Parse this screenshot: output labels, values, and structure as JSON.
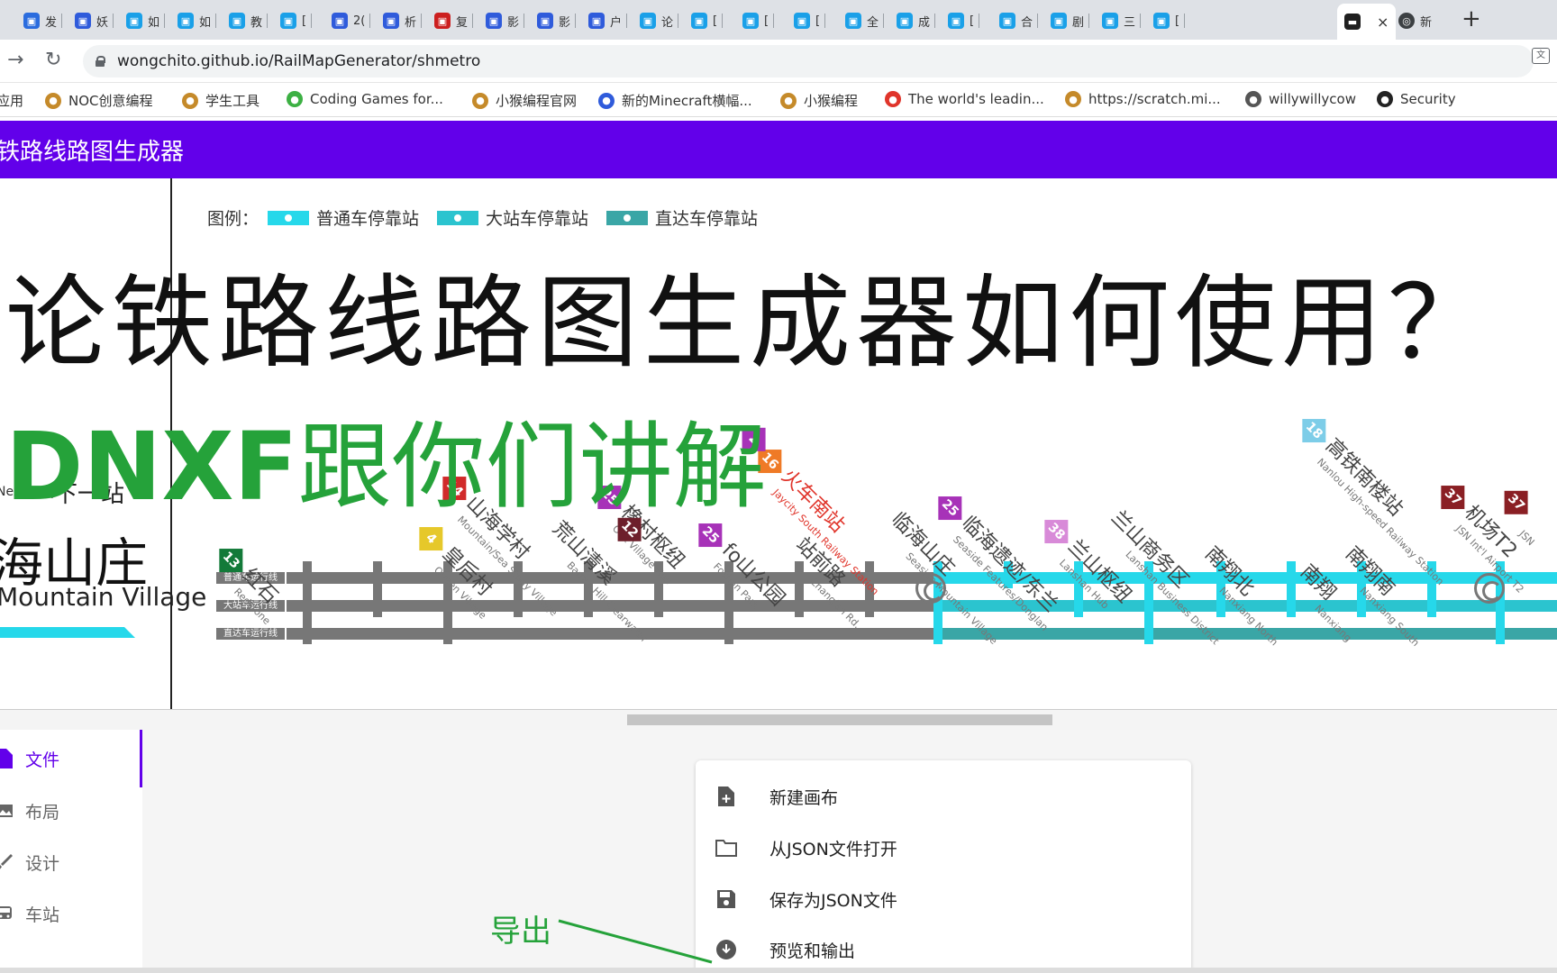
{
  "browser": {
    "tabs": [
      {
        "label": "发",
        "color": "#2b6cde"
      },
      {
        "label": "妖",
        "color": "#2f5bdb"
      },
      {
        "label": "如",
        "color": "#1aa0e8"
      },
      {
        "label": "如",
        "color": "#1aa0e8"
      },
      {
        "label": "教",
        "color": "#1aa0e8"
      },
      {
        "label": "[",
        "color": "#1aa0e8"
      },
      {
        "label": "2(",
        "color": "#2f5bdb"
      },
      {
        "label": "析",
        "color": "#2f5bdb"
      },
      {
        "label": "复",
        "color": "#cc1f1f"
      },
      {
        "label": "影",
        "color": "#2f5bdb"
      },
      {
        "label": "影",
        "color": "#2f5bdb"
      },
      {
        "label": "户",
        "color": "#2f5bdb"
      },
      {
        "label": "论",
        "color": "#1aa0e8"
      },
      {
        "label": "[",
        "color": "#1aa0e8"
      },
      {
        "label": "[",
        "color": "#1aa0e8"
      },
      {
        "label": "[",
        "color": "#1aa0e8"
      },
      {
        "label": "全",
        "color": "#1aa0e8"
      },
      {
        "label": "成",
        "color": "#1aa0e8"
      },
      {
        "label": "[",
        "color": "#1aa0e8"
      },
      {
        "label": "合",
        "color": "#1aa0e8"
      },
      {
        "label": "剧",
        "color": "#1aa0e8"
      },
      {
        "label": "三",
        "color": "#1aa0e8"
      },
      {
        "label": "[",
        "color": "#1aa0e8"
      }
    ],
    "active_tab": {
      "label": "",
      "close": "×"
    },
    "last_tab": {
      "label": "新"
    },
    "new_tab": "+",
    "url": "wongchito.github.io/RailMapGenerator/shmetro",
    "bookmarks": [
      {
        "label": "应用",
        "color": "#4285f4"
      },
      {
        "label": "NOC创意编程",
        "color": "#c58a2a"
      },
      {
        "label": "学生工具",
        "color": "#c58a2a"
      },
      {
        "label": "Coding Games for...",
        "color": "#3cb043"
      },
      {
        "label": "小猴编程官网",
        "color": "#c58a2a"
      },
      {
        "label": "新的Minecraft横幅...",
        "color": "#2f5bdb"
      },
      {
        "label": "小猴编程",
        "color": "#c58a2a"
      },
      {
        "label": "The world's leadin...",
        "color": "#e0342a"
      },
      {
        "label": "https://scratch.mi...",
        "color": "#c58a2a"
      },
      {
        "label": "willywillycow",
        "color": "#555555"
      },
      {
        "label": "Security",
        "color": "#222222"
      }
    ]
  },
  "app": {
    "title": "铁路线路图生成器",
    "accent": "#6200ea"
  },
  "preview": {
    "legend_label": "图例：",
    "legend": [
      {
        "label": "普通车停靠站",
        "color": "#26d8ea"
      },
      {
        "label": "大站车停靠站",
        "color": "#2bc4cf"
      },
      {
        "label": "直达车停靠站",
        "color": "#3aa6a6"
      }
    ],
    "headline": "论铁路线路图生成器如何使用？",
    "subline_latin": "DNXF",
    "subline_cn": "跟你们讲解",
    "next_stop_en": "Next Stop",
    "next_stop_cn": "下一站",
    "current_cn": "海山庄",
    "current_en": "Mountain Village",
    "track_labels": [
      "普通车运行线",
      "大站车运行线",
      "直达车运行线"
    ],
    "stations": [
      {
        "line": "13",
        "color": "#137a39",
        "cn": "红石",
        "en": "Redstone"
      },
      {
        "line": "4",
        "color": "#e6c82a",
        "cn": "皇后村",
        "en": "Queen Village"
      },
      {
        "line": "14",
        "color": "#d12a2a",
        "cn": "山海学村",
        "en": "Mountain/Sea Study Village"
      },
      {
        "line": "",
        "color": "",
        "cn": "荒山清溪",
        "en": "Barren Hill Clearwater"
      },
      {
        "line": "25",
        "color": "#a732b8",
        "cn": "橡村枢纽",
        "en": "Oak Village Hub"
      },
      {
        "line": "12",
        "color": "#6d1f2b",
        "cn": "",
        "en": ""
      },
      {
        "line": "25",
        "color": "#a732b8",
        "cn": "fo山公园",
        "en": "Foshan Park"
      },
      {
        "line": "",
        "color": "",
        "cn": "站前路",
        "en": "Zhanqian Rd."
      },
      {
        "line": "16",
        "color": "#ef7a26",
        "cn": "火车南站",
        "en": "Jaycity South Railway Station"
      },
      {
        "line": "2",
        "color": "#a732b8",
        "cn": "",
        "en": ""
      },
      {
        "line": "",
        "color": "",
        "cn": "临海山庄",
        "en": "Seaside Mountain Village"
      },
      {
        "line": "25",
        "color": "#a732b8",
        "cn": "临海遗迹/东兰",
        "en": "Seaside Features/Donglan"
      },
      {
        "line": "38",
        "color": "#d88ad8",
        "cn": "兰山枢纽",
        "en": "Lanshan Hub"
      },
      {
        "line": "",
        "color": "",
        "cn": "兰山商务区",
        "en": "Lanshan Business District"
      },
      {
        "line": "",
        "color": "",
        "cn": "南翔北",
        "en": "Nanxiang North"
      },
      {
        "line": "",
        "color": "",
        "cn": "南翔",
        "en": "Nanxiang"
      },
      {
        "line": "",
        "color": "",
        "cn": "南翔南",
        "en": "Nanxiang South"
      },
      {
        "line": "18",
        "color": "#7dcde8",
        "cn": "高铁南楼站",
        "en": "Nanlou High-speed Railway Station"
      },
      {
        "line": "37",
        "color": "#8a1f24",
        "cn": "机场T2",
        "en": "JSN Int'l Airport T2"
      },
      {
        "line": "37",
        "color": "#8a1f24",
        "cn": "",
        "en": "JSN"
      }
    ],
    "annotation": "导出",
    "track_colors": {
      "gray": "#777777",
      "cyan": "#26d8ea",
      "teal": "#3aa6a6"
    }
  },
  "sidebar": {
    "items": [
      {
        "label": "文件",
        "icon": "file-icon"
      },
      {
        "label": "布局",
        "icon": "image-icon"
      },
      {
        "label": "设计",
        "icon": "brush-icon"
      },
      {
        "label": "车站",
        "icon": "train-icon"
      }
    ]
  },
  "file_menu": {
    "items": [
      {
        "label": "新建画布",
        "icon": "new-file-icon"
      },
      {
        "label": "从JSON文件打开",
        "icon": "folder-icon"
      },
      {
        "label": "保存为JSON文件",
        "icon": "save-icon"
      },
      {
        "label": "预览和输出",
        "icon": "export-icon"
      }
    ]
  }
}
